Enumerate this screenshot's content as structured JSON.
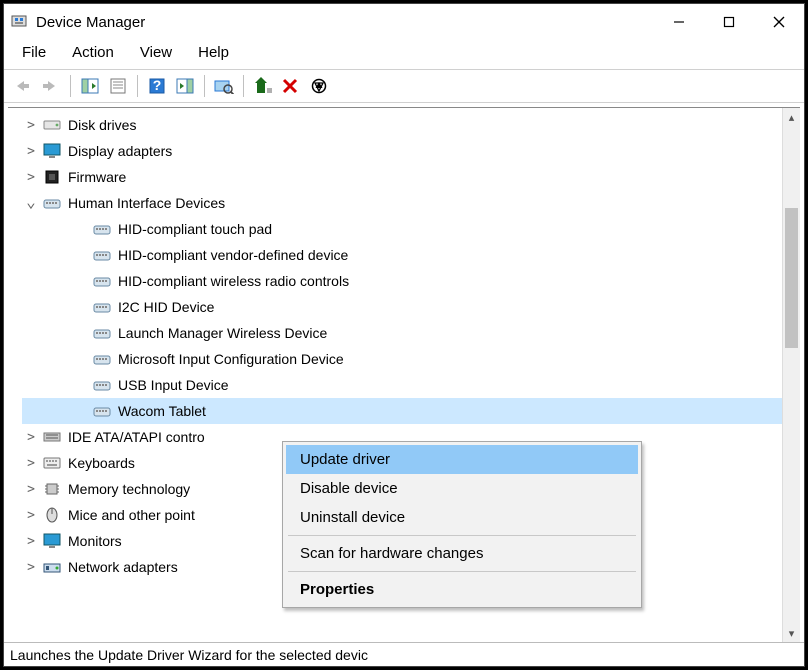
{
  "window": {
    "title": "Device Manager"
  },
  "menu": {
    "file": "File",
    "action": "Action",
    "view": "View",
    "help": "Help"
  },
  "tree": [
    {
      "label": "Disk drives",
      "icon": "disk",
      "expanded": false
    },
    {
      "label": "Display adapters",
      "icon": "display",
      "expanded": false
    },
    {
      "label": "Firmware",
      "icon": "firmware",
      "expanded": false
    },
    {
      "label": "Human Interface Devices",
      "icon": "hid",
      "expanded": true,
      "children": [
        {
          "label": "HID-compliant touch pad",
          "icon": "hid"
        },
        {
          "label": "HID-compliant vendor-defined device",
          "icon": "hid"
        },
        {
          "label": "HID-compliant wireless radio controls",
          "icon": "hid"
        },
        {
          "label": "I2C HID Device",
          "icon": "hid"
        },
        {
          "label": "Launch Manager Wireless Device",
          "icon": "hid"
        },
        {
          "label": "Microsoft Input Configuration Device",
          "icon": "hid"
        },
        {
          "label": "USB Input Device",
          "icon": "hid"
        },
        {
          "label": "Wacom Tablet",
          "icon": "hid",
          "selected": true
        }
      ]
    },
    {
      "label": "IDE ATA/ATAPI contro",
      "icon": "ide",
      "expanded": false
    },
    {
      "label": "Keyboards",
      "icon": "keyboard",
      "expanded": false
    },
    {
      "label": "Memory technology",
      "icon": "chip",
      "expanded": false
    },
    {
      "label": "Mice and other point",
      "icon": "mouse",
      "expanded": false
    },
    {
      "label": "Monitors",
      "icon": "monitor",
      "expanded": false
    },
    {
      "label": "Network adapters",
      "icon": "network",
      "expanded": false
    }
  ],
  "context_menu": {
    "update": "Update driver",
    "disable": "Disable device",
    "uninstall": "Uninstall device",
    "scan": "Scan for hardware changes",
    "properties": "Properties"
  },
  "status": "Launches the Update Driver Wizard for the selected devic"
}
